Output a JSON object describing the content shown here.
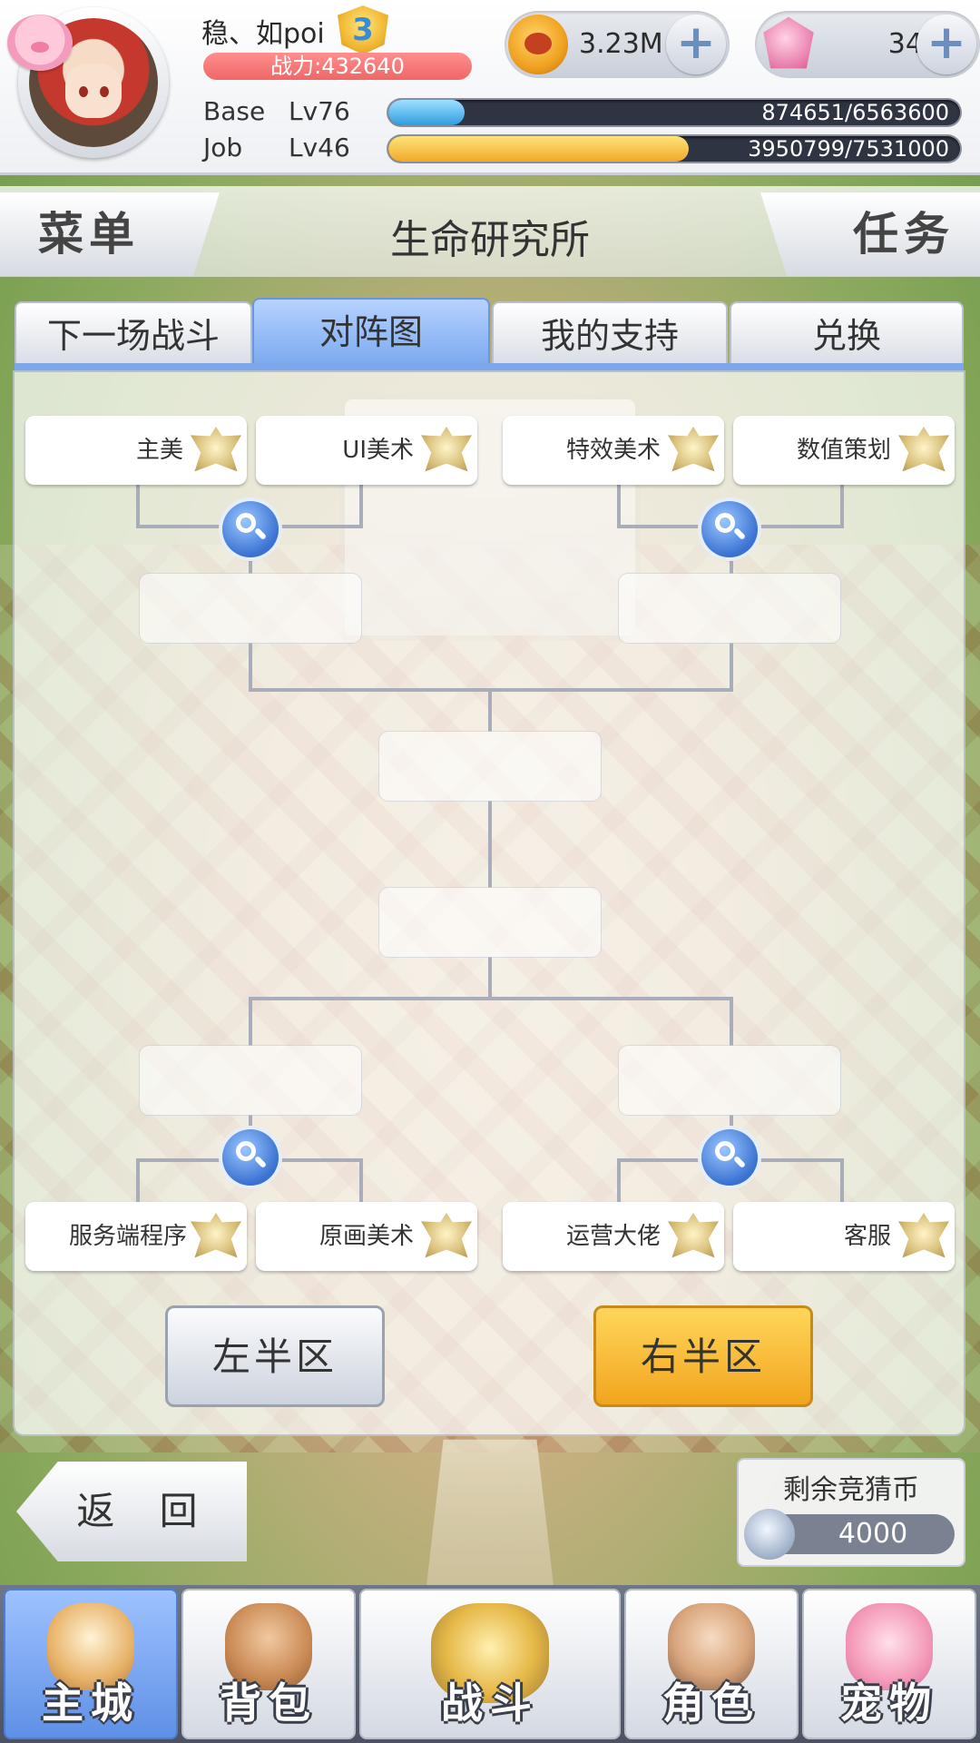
{
  "player": {
    "name": "稳、如poi",
    "vip_level": "3",
    "power_text": "战力:432640"
  },
  "levels": {
    "base": {
      "label": "Base",
      "level": "Lv76",
      "progress_text": "874651/6563600",
      "current": 874651,
      "max": 6563600
    },
    "job": {
      "label": "Job",
      "level": "Lv46",
      "progress_text": "3950799/7531000",
      "current": 3950799,
      "max": 7531000
    }
  },
  "currency": {
    "coins": {
      "value": "3.23M",
      "icon": "coin-icon"
    },
    "gems": {
      "value": "342",
      "icon": "gem-icon"
    },
    "add_symbol": "+"
  },
  "header": {
    "menu_label": "菜单",
    "title": "生命研究所",
    "task_label": "任务"
  },
  "tabs": [
    {
      "label": "下一场战斗",
      "active": false
    },
    {
      "label": "对阵图",
      "active": true
    },
    {
      "label": "我的支持",
      "active": false
    },
    {
      "label": "兑换",
      "active": false
    }
  ],
  "bracket": {
    "top_teams": [
      "主美",
      "UI美术",
      "特效美术",
      "数值策划"
    ],
    "bottom_teams": [
      "服务端程序",
      "原画美术",
      "运营大佬",
      "客服"
    ]
  },
  "half_buttons": {
    "left": "左半区",
    "right": "右半区",
    "selected": "right"
  },
  "back_label": "返 回",
  "guess_coins": {
    "label": "剩余竞猜币",
    "value": "4000"
  },
  "nav": [
    {
      "label": "主城",
      "icon": "castle-icon",
      "active": true
    },
    {
      "label": "背包",
      "icon": "backpack-icon",
      "active": false
    },
    {
      "label": "战斗",
      "icon": "battle-icon",
      "active": false
    },
    {
      "label": "角色",
      "icon": "character-icon",
      "active": false
    },
    {
      "label": "宠物",
      "icon": "pet-icon",
      "active": false
    }
  ],
  "colors": {
    "accent_blue": "#7ea7ea",
    "accent_gold": "#f2a51e",
    "power_red": "#ef6767"
  }
}
